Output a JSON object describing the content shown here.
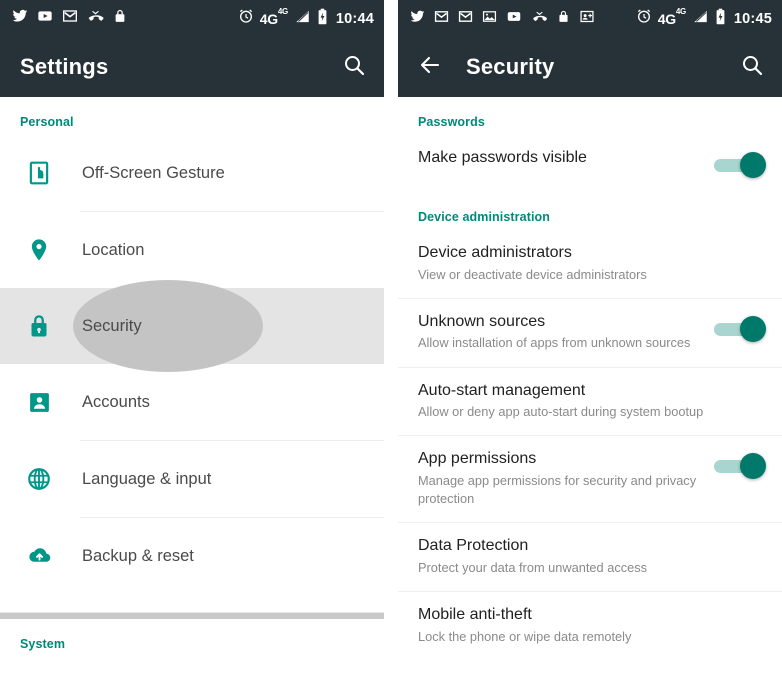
{
  "left_phone": {
    "statusbar": {
      "icons": [
        "twitter-icon",
        "youtube-icon",
        "gmail-icon",
        "missed-call-icon",
        "lock-icon"
      ],
      "alarm_icon": "alarm-icon",
      "network_label": "4G",
      "network_sup": "4G",
      "signal_icon": "signal-bars-icon",
      "battery_icon": "battery-charging-icon",
      "time": "10:44"
    },
    "appbar": {
      "title": "Settings",
      "search_icon": "search-icon"
    },
    "sections": [
      {
        "header": "Personal"
      },
      {
        "header": "System"
      }
    ],
    "items": [
      {
        "label": "Off-Screen Gesture",
        "icon": "off-screen-gesture-icon",
        "selected": false,
        "divider_after": true
      },
      {
        "label": "Location",
        "icon": "location-pin-icon",
        "selected": false,
        "divider_after": false
      },
      {
        "label": "Security",
        "icon": "lock-shield-icon",
        "selected": true,
        "divider_after": false
      },
      {
        "label": "Accounts",
        "icon": "account-person-icon",
        "selected": false,
        "divider_after": true
      },
      {
        "label": "Language & input",
        "icon": "globe-icon",
        "selected": false,
        "divider_after": true
      },
      {
        "label": "Backup & reset",
        "icon": "cloud-upload-icon",
        "selected": false,
        "divider_after": false
      }
    ]
  },
  "right_phone": {
    "statusbar": {
      "icons": [
        "twitter-icon",
        "gmail-icon",
        "gmail-alt-icon",
        "image-icon",
        "youtube-icon",
        "missed-call-icon",
        "lock-icon",
        "contact-add-icon"
      ],
      "alarm_icon": "alarm-icon",
      "network_label": "4G",
      "network_sup": "4G",
      "signal_icon": "signal-bars-icon",
      "battery_icon": "battery-charging-icon",
      "time": "10:45"
    },
    "appbar": {
      "back_icon": "back-arrow-icon",
      "title": "Security",
      "search_icon": "search-icon"
    },
    "groups": [
      {
        "header": "Passwords",
        "rows": [
          {
            "title": "Make passwords visible",
            "subtitle": "",
            "toggle": true,
            "toggle_on": true,
            "divider_after": false
          }
        ]
      },
      {
        "header": "Device administration",
        "rows": [
          {
            "title": "Device administrators",
            "subtitle": "View or deactivate device administrators",
            "toggle": false,
            "toggle_on": false,
            "divider_after": true
          },
          {
            "title": "Unknown sources",
            "subtitle": "Allow installation of apps from unknown sources",
            "toggle": true,
            "toggle_on": true,
            "divider_after": true
          },
          {
            "title": "Auto-start management",
            "subtitle": "Allow or deny app auto-start during system bootup",
            "toggle": false,
            "toggle_on": false,
            "divider_after": true
          },
          {
            "title": "App permissions",
            "subtitle": "Manage app permissions for security and privacy protection",
            "toggle": true,
            "toggle_on": true,
            "divider_after": true
          },
          {
            "title": "Data Protection",
            "subtitle": "Protect your data from unwanted access",
            "toggle": false,
            "toggle_on": false,
            "divider_after": true
          },
          {
            "title": "Mobile anti-theft",
            "subtitle": "Lock the phone or wipe data remotely",
            "toggle": false,
            "toggle_on": false,
            "divider_after": false
          }
        ]
      }
    ]
  },
  "colors": {
    "accent_teal": "#009688",
    "header_teal": "#00897b",
    "appbar_dark": "#263238",
    "selected_row": "#e4e4e4",
    "ripple_gray": "#c4c4c4",
    "toggle_track": "#a8d5cf",
    "toggle_thumb": "#00796b"
  }
}
